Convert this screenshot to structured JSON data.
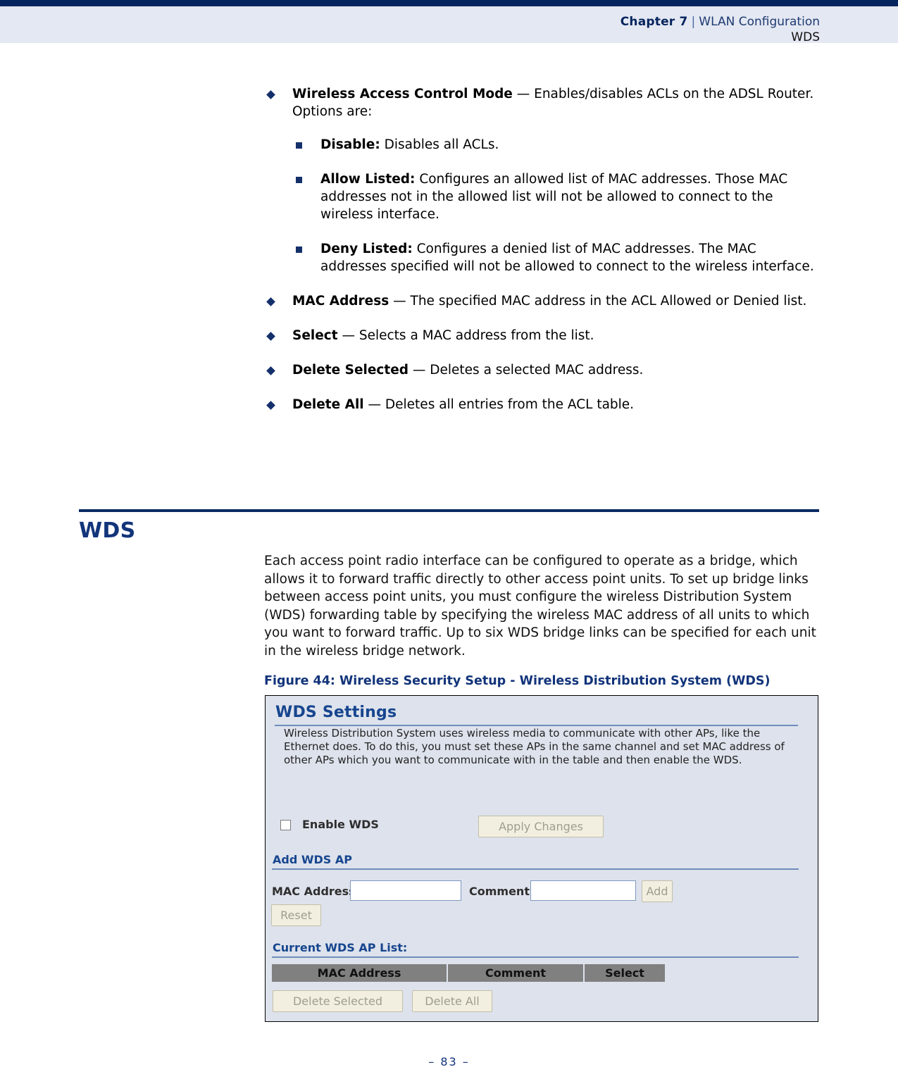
{
  "header": {
    "chapter_label": "Chapter 7",
    "chapter_small_caps_lead": "C",
    "separator": "|",
    "section": "WLAN Configuration",
    "subsection": "WDS"
  },
  "colors": {
    "navy_rule": "#04245e",
    "header_band": "#e4e8f2",
    "heading_blue": "#12347a",
    "bullet_navy": "#14306b",
    "figure_bg": "#dde2ec",
    "figure_title_blue": "#17468f",
    "table_header_gray": "#808080",
    "button_face": "#f2efe0",
    "button_text": "#9e9e8e"
  },
  "bullets": [
    {
      "term": "Wireless Access Control Mode",
      "dash": "—",
      "text": "Enables/disables ACLs on the ADSL Router. Options are:",
      "sub": [
        {
          "term": "Disable:",
          "text": "Disables all ACLs."
        },
        {
          "term": "Allow Listed:",
          "text": "Configures an allowed list of MAC addresses. Those MAC addresses not in the allowed list will not be allowed to connect to the wireless interface."
        },
        {
          "term": "Deny Listed:",
          "text": "Configures a denied list of MAC addresses. The MAC addresses specified will not be allowed to connect to the wireless interface."
        }
      ]
    },
    {
      "term": "MAC Address",
      "dash": "—",
      "text": "The specified MAC address in the ACL Allowed or Denied list.",
      "sub": []
    },
    {
      "term": "Select",
      "dash": "—",
      "text": "Selects a MAC address from the list.",
      "sub": []
    },
    {
      "term": "Delete Selected",
      "dash": "—",
      "text": "Deletes a selected MAC address.",
      "sub": []
    },
    {
      "term": "Delete All",
      "dash": "—",
      "text": "Deletes all entries from the ACL table.",
      "sub": []
    }
  ],
  "section": {
    "title": "WDS",
    "paragraph": "Each access point radio interface can be configured to operate as a bridge, which allows it to forward traffic directly to other access point units. To set up bridge links between access point units, you must configure the wireless Distribution System (WDS) forwarding table by specifying the wireless MAC address of all units to which you want to forward traffic. Up to six WDS bridge links can be specified for each unit in the wireless bridge network.",
    "figure_caption": "Figure 44:  Wireless Security Setup - Wireless Distribution System (WDS)"
  },
  "figure": {
    "title": "WDS Settings",
    "description": "Wireless Distribution System uses wireless media to communicate with other APs, like the Ethernet does. To do this, you must set these APs in the same channel and set MAC address of other APs which you want to communicate with in the table and then enable the WDS.",
    "enable_wds_label": "Enable WDS",
    "enable_wds_checked": false,
    "apply_changes_label": "Apply Changes",
    "add_wds_ap_heading": "Add WDS AP",
    "mac_address_label": "MAC Address",
    "mac_address_value": "",
    "comment_label": "Comment",
    "comment_value": "",
    "add_label": "Add",
    "reset_label": "Reset",
    "current_list_heading": "Current WDS AP List:",
    "table_headers": [
      "MAC Address",
      "Comment",
      "Select"
    ],
    "table_rows": [],
    "delete_selected_label": "Delete Selected",
    "delete_all_label": "Delete All"
  },
  "footer": {
    "page_number": "–  83  –"
  }
}
